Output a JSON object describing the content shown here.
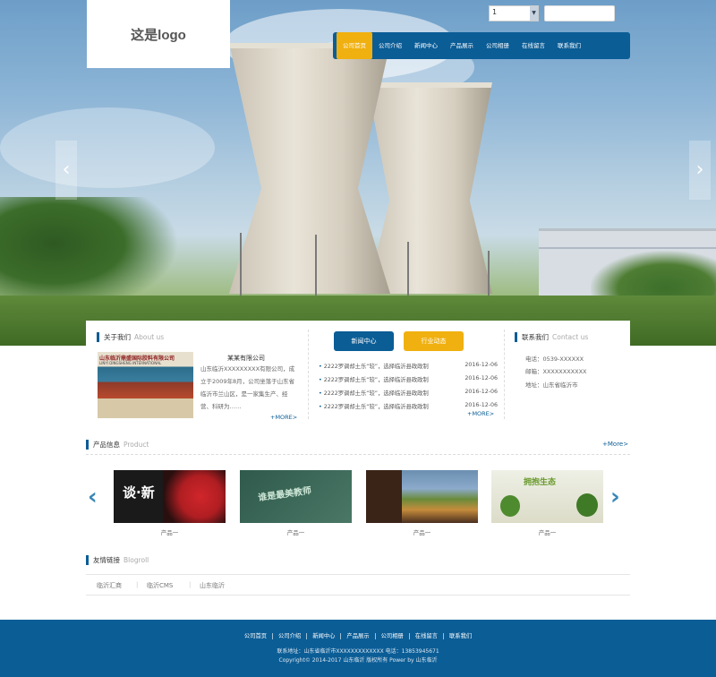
{
  "header": {
    "logo_text": "这是logo",
    "lang_select": "1",
    "search_placeholder": ""
  },
  "nav": {
    "items": [
      "公司首页",
      "公司介绍",
      "新闻中心",
      "产品展示",
      "公司相册",
      "在线留言",
      "联系我们"
    ],
    "active_index": 0
  },
  "slider": {
    "prev_label": "‹",
    "next_label": "›"
  },
  "about": {
    "title": "关于我们",
    "title_en": "About us",
    "company": "某某有限公司",
    "text": "山东临沂XXXXXXXXX有限公司，成立于2009年8月，公司坐落于山东省临沂市兰山区，是一家集生产、经营、科研为……",
    "text_lines": [
      "山东临沂XXXXXXXXX有限公司，成",
      "立于2009年8月，公司坐落于山东省",
      "临沂市兰山区，是一家集生产、经",
      "营、科研为……"
    ],
    "img_sign": "山东临沂鼎盛国际胶料有限公司",
    "img_sign_sub": "LINYI DINGSHENG INTERNATIONAL",
    "more": "+MORE>"
  },
  "news": {
    "tabs": [
      "新闻中心",
      "行业动态"
    ],
    "tab_colors": [
      "#0b5d96",
      "#f0b010"
    ],
    "items": [
      {
        "title": "2222罗调却土乐“较”，选择临沂县政政制",
        "date": "2016-12-06"
      },
      {
        "title": "2222罗调却土乐“较”，选择临沂县政政制",
        "date": "2016-12-06"
      },
      {
        "title": "2222罗调却土乐“较”，选择临沂县政政制",
        "date": "2016-12-06"
      },
      {
        "title": "2222罗调却土乐“较”，选择临沂县政政制",
        "date": "2016-12-06"
      }
    ],
    "more": "+MORE>"
  },
  "contact": {
    "title": "联系我们",
    "title_en": "Contact us",
    "phone": "电话：0539-XXXXXX",
    "email": "邮箱：XXXXXXXXXXX",
    "address": "地址：山东省临沂市"
  },
  "products": {
    "title": "产品信息",
    "title_en": "Product",
    "more": "+More>",
    "items": [
      {
        "caption": "产品一",
        "text": "谈·新"
      },
      {
        "caption": "产品一",
        "text": "谁是最美教师"
      },
      {
        "caption": "产品一",
        "text": ""
      },
      {
        "caption": "产品一",
        "text": "拥抱生态"
      }
    ]
  },
  "friend_links": {
    "title": "友情链接",
    "title_en": "Blogroll",
    "items": [
      "临沂汇商",
      "临沂CMS",
      "山东临沂"
    ]
  },
  "footer": {
    "nav": [
      "公司首页",
      "公司介绍",
      "新闻中心",
      "产品展示",
      "公司相册",
      "在线留言",
      "联系我们"
    ],
    "address": "联系地址：山东省临沂市XXXXXXXXXXXXX  电话：13853945671",
    "copyright": "Copyright© 2014-2017 山东临沂 版权所有 Power by 山东临沂"
  }
}
